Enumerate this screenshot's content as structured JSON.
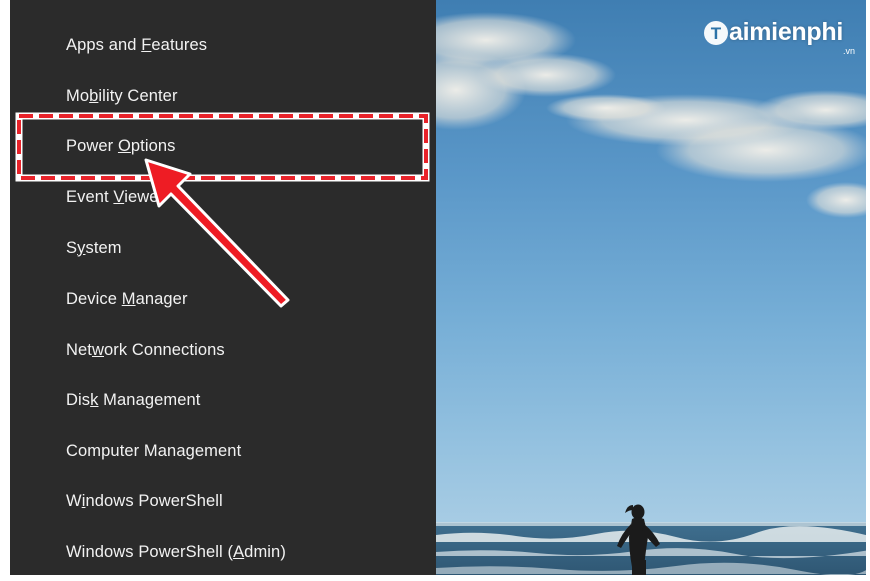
{
  "menu": {
    "items": [
      {
        "pre": "Apps and ",
        "acc": "F",
        "post": "eatures"
      },
      {
        "pre": "Mo",
        "acc": "b",
        "post": "ility Center"
      },
      {
        "pre": "Power ",
        "acc": "O",
        "post": "ptions"
      },
      {
        "pre": "Event ",
        "acc": "V",
        "post": "iewer"
      },
      {
        "pre": "S",
        "acc": "y",
        "post": "stem"
      },
      {
        "pre": "Device ",
        "acc": "M",
        "post": "anager"
      },
      {
        "pre": "Net",
        "acc": "w",
        "post": "ork Connections"
      },
      {
        "pre": "Dis",
        "acc": "k",
        "post": " Management"
      },
      {
        "pre": "Computer Mana",
        "acc": "g",
        "post": "ement"
      },
      {
        "pre": "W",
        "acc": "i",
        "post": "ndows PowerShell"
      },
      {
        "pre": "Windows PowerShell (",
        "acc": "A",
        "post": "dmin)"
      }
    ],
    "highlighted_index": 2
  },
  "watermark": {
    "text": "aimienphi",
    "tld": ".vn",
    "logo_letter": "T"
  },
  "colors": {
    "menu_bg": "#2b2b2b",
    "menu_text": "#f2f2f2",
    "highlight": "#e8232a",
    "arrow": "#ee1c24"
  },
  "icons": {
    "arrow": "red-pointer-arrow-icon",
    "logo": "taimienphi-logo-icon"
  }
}
